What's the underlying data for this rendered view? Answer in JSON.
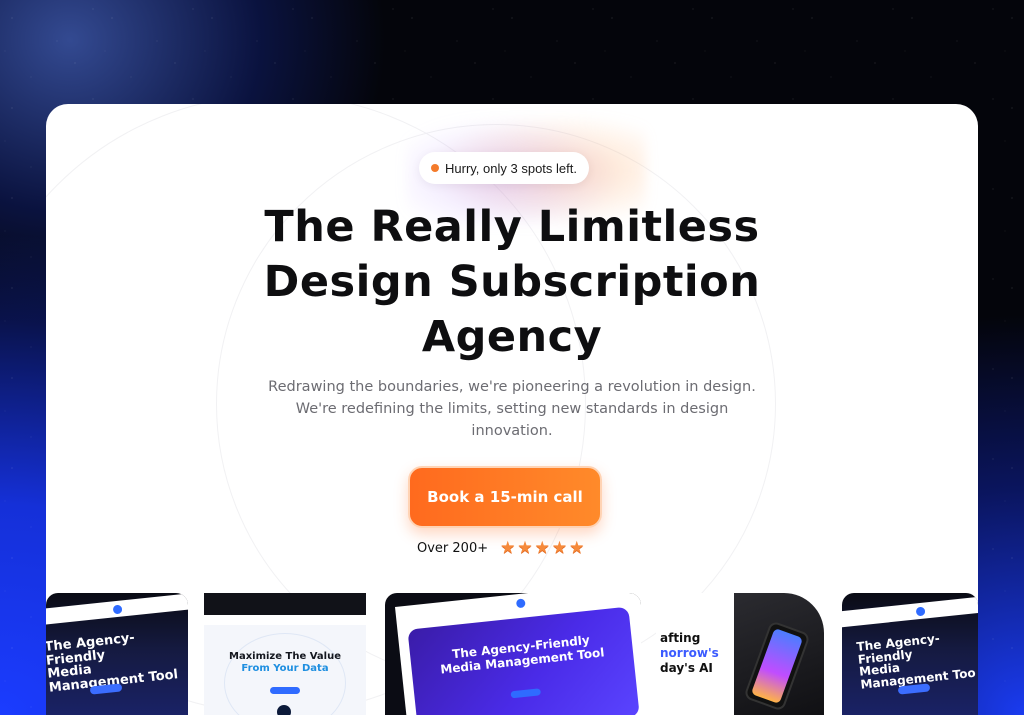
{
  "badge": {
    "text": "Hurry, only 3 spots left."
  },
  "hero": {
    "title_lines": [
      "The Really Limitless",
      "Design Subscription",
      "Agency"
    ],
    "subtitle_lines": [
      "Redrawing the boundaries, we're pioneering a revolution in design.",
      "We're redefining the limits, setting new standards in design",
      "innovation."
    ]
  },
  "cta": {
    "label": "Book a 15-min call"
  },
  "rating": {
    "count_label": "Over 200+",
    "stars": 5
  },
  "colors": {
    "accent": "#ff6a1e",
    "badge_dot": "#f47b2b",
    "brand_blue": "#2f6bff"
  },
  "thumbnails": [
    {
      "title_lines": [
        "The Agency-Friendly",
        "Media Management Tool"
      ]
    },
    {
      "title_lines": [
        "Maximize The Value",
        "From Your Data"
      ]
    },
    {
      "title_lines": [
        "The Agency-Friendly",
        "Media Management Tool"
      ]
    },
    {
      "title_lines": [
        "afting",
        "norrow's",
        "day's AI"
      ]
    },
    {
      "title_lines": [
        "The Agency-Friendly",
        "Media Management Too"
      ]
    }
  ]
}
